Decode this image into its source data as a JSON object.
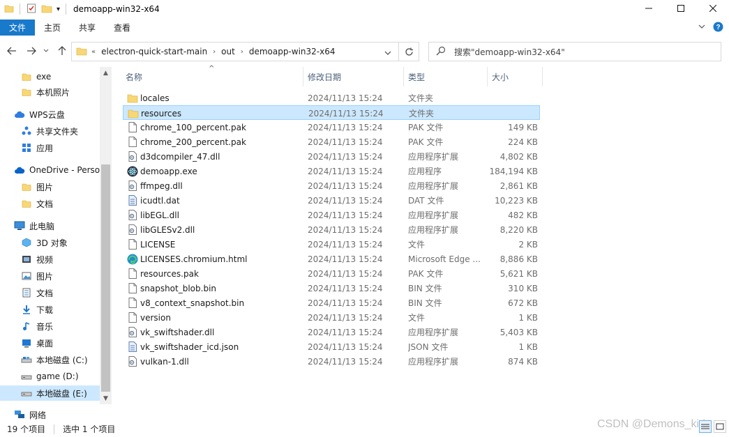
{
  "window": {
    "title": "demoapp-win32-x64"
  },
  "ribbon": {
    "file_tab": "文件",
    "tabs": [
      "主页",
      "共享",
      "查看"
    ]
  },
  "address": {
    "prefix": "«",
    "segments": [
      "electron-quick-start-main",
      "out",
      "demoapp-win32-x64"
    ]
  },
  "search": {
    "placeholder": "搜索\"demoapp-win32-x64\""
  },
  "nav": {
    "items": [
      {
        "label": "exe",
        "icon": "folder-icon"
      },
      {
        "label": "本机照片",
        "icon": "folder-icon"
      },
      {
        "label": "WPS云盘",
        "icon": "cloud-icon"
      },
      {
        "label": "共享文件夹",
        "icon": "share-icon"
      },
      {
        "label": "应用",
        "icon": "apps-icon"
      },
      {
        "label": "OneDrive - Perso",
        "icon": "onedrive-icon"
      },
      {
        "label": "图片",
        "icon": "folder-icon"
      },
      {
        "label": "文档",
        "icon": "folder-icon"
      },
      {
        "label": "此电脑",
        "icon": "pc-icon"
      },
      {
        "label": "3D 对象",
        "icon": "3d-objects-icon"
      },
      {
        "label": "视频",
        "icon": "video-icon"
      },
      {
        "label": "图片",
        "icon": "pictures-icon"
      },
      {
        "label": "文档",
        "icon": "documents-icon"
      },
      {
        "label": "下载",
        "icon": "download-icon"
      },
      {
        "label": "音乐",
        "icon": "music-icon"
      },
      {
        "label": "桌面",
        "icon": "desktop-icon"
      },
      {
        "label": "本地磁盘 (C:)",
        "icon": "drive-icon"
      },
      {
        "label": "game (D:)",
        "icon": "drive-icon"
      },
      {
        "label": "本地磁盘 (E:)",
        "icon": "drive-icon"
      },
      {
        "label": "网络",
        "icon": "network-icon"
      }
    ]
  },
  "columns": {
    "name": "名称",
    "date": "修改日期",
    "type": "类型",
    "size": "大小"
  },
  "files": [
    {
      "name": "locales",
      "date": "2024/11/13 15:24",
      "type": "文件夹",
      "size": "",
      "icon": "folder-icon"
    },
    {
      "name": "resources",
      "date": "2024/11/13 15:24",
      "type": "文件夹",
      "size": "",
      "icon": "folder-icon"
    },
    {
      "name": "chrome_100_percent.pak",
      "date": "2024/11/13 15:24",
      "type": "PAK 文件",
      "size": "149 KB",
      "icon": "file-icon"
    },
    {
      "name": "chrome_200_percent.pak",
      "date": "2024/11/13 15:24",
      "type": "PAK 文件",
      "size": "224 KB",
      "icon": "file-icon"
    },
    {
      "name": "d3dcompiler_47.dll",
      "date": "2024/11/13 15:24",
      "type": "应用程序扩展",
      "size": "4,802 KB",
      "icon": "dll-icon"
    },
    {
      "name": "demoapp.exe",
      "date": "2024/11/13 15:24",
      "type": "应用程序",
      "size": "184,194 KB",
      "icon": "electron-icon"
    },
    {
      "name": "ffmpeg.dll",
      "date": "2024/11/13 15:24",
      "type": "应用程序扩展",
      "size": "2,861 KB",
      "icon": "dll-icon"
    },
    {
      "name": "icudtl.dat",
      "date": "2024/11/13 15:24",
      "type": "DAT 文件",
      "size": "10,223 KB",
      "icon": "dat-icon"
    },
    {
      "name": "libEGL.dll",
      "date": "2024/11/13 15:24",
      "type": "应用程序扩展",
      "size": "482 KB",
      "icon": "dll-icon"
    },
    {
      "name": "libGLESv2.dll",
      "date": "2024/11/13 15:24",
      "type": "应用程序扩展",
      "size": "8,220 KB",
      "icon": "dll-icon"
    },
    {
      "name": "LICENSE",
      "date": "2024/11/13 15:24",
      "type": "文件",
      "size": "2 KB",
      "icon": "file-icon"
    },
    {
      "name": "LICENSES.chromium.html",
      "date": "2024/11/13 15:24",
      "type": "Microsoft Edge ...",
      "size": "8,886 KB",
      "icon": "edge-icon"
    },
    {
      "name": "resources.pak",
      "date": "2024/11/13 15:24",
      "type": "PAK 文件",
      "size": "5,621 KB",
      "icon": "file-icon"
    },
    {
      "name": "snapshot_blob.bin",
      "date": "2024/11/13 15:24",
      "type": "BIN 文件",
      "size": "310 KB",
      "icon": "file-icon"
    },
    {
      "name": "v8_context_snapshot.bin",
      "date": "2024/11/13 15:24",
      "type": "BIN 文件",
      "size": "672 KB",
      "icon": "file-icon"
    },
    {
      "name": "version",
      "date": "2024/11/13 15:24",
      "type": "文件",
      "size": "1 KB",
      "icon": "file-icon"
    },
    {
      "name": "vk_swiftshader.dll",
      "date": "2024/11/13 15:24",
      "type": "应用程序扩展",
      "size": "5,403 KB",
      "icon": "dll-icon"
    },
    {
      "name": "vk_swiftshader_icd.json",
      "date": "2024/11/13 15:24",
      "type": "JSON 文件",
      "size": "1 KB",
      "icon": "dat-icon"
    },
    {
      "name": "vulkan-1.dll",
      "date": "2024/11/13 15:24",
      "type": "应用程序扩展",
      "size": "874 KB",
      "icon": "dll-icon"
    }
  ],
  "selected_file_index": 1,
  "selected_nav_index": 18,
  "status": {
    "count": "19 个项目",
    "selection": "选中 1 个项目"
  },
  "watermark": "CSDN @Demons_kirit",
  "colors": {
    "accent": "#1979ca",
    "selection": "#cce8ff",
    "folder": "#f8d775"
  }
}
